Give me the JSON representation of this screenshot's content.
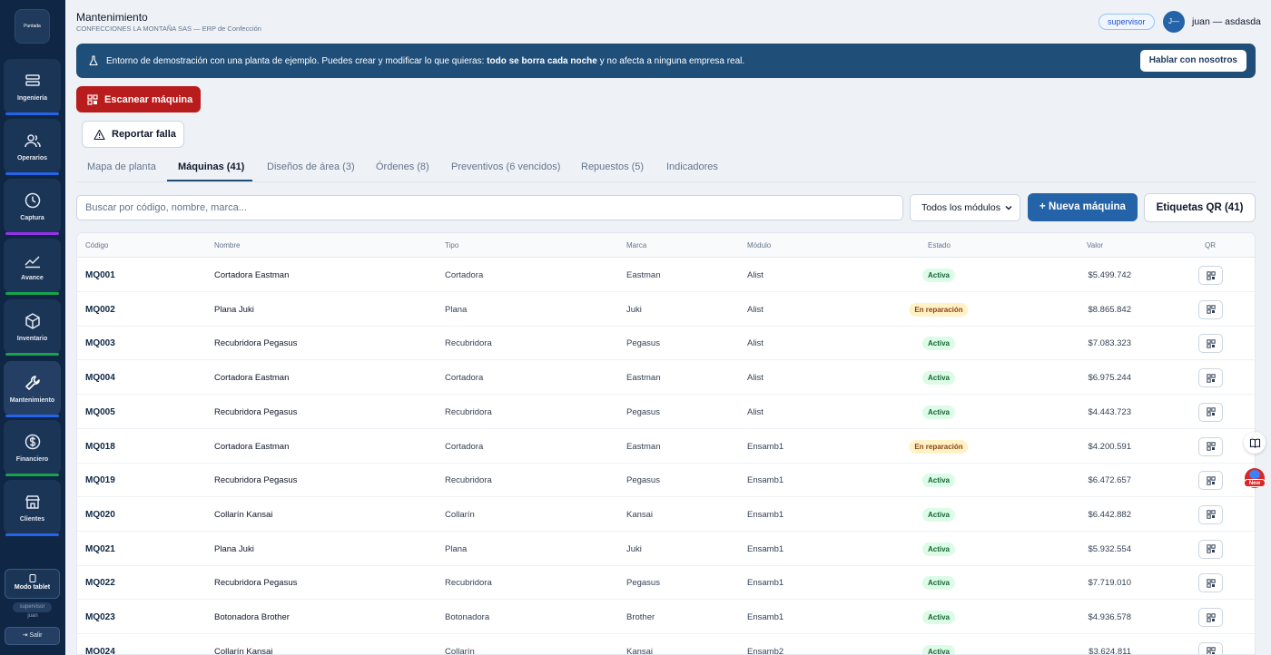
{
  "sidebar": {
    "logo_text": "Puntada",
    "items": [
      {
        "label": "Ingeniería",
        "icon": "machine-icon",
        "accent": "#2563eb"
      },
      {
        "label": "Operarios",
        "icon": "users-icon",
        "accent": "#2563eb"
      },
      {
        "label": "Captura",
        "icon": "clock-icon",
        "accent": "#9333ea"
      },
      {
        "label": "Avance",
        "icon": "trend-icon",
        "accent": "#16a34a"
      },
      {
        "label": "Inventario",
        "icon": "box-icon",
        "accent": "#16a34a"
      },
      {
        "label": "Mantenimiento",
        "icon": "wrench-icon",
        "accent": "#2563eb"
      },
      {
        "label": "Financiero",
        "icon": "dollar-icon",
        "accent": "#16a34a"
      },
      {
        "label": "Clientes",
        "icon": "store-icon",
        "accent": "#2563eb"
      }
    ],
    "tablet_label": "Modo tablet",
    "role": "supervisor",
    "user": "juan",
    "logout_label": "Salir"
  },
  "header": {
    "title": "Mantenimiento",
    "subtitle": "CONFECCIONES LA MONTAÑA SAS — ERP de Confección",
    "role_badge": "supervisor",
    "avatar_initials": "J—",
    "user_name": "juan — asdasda"
  },
  "banner": {
    "text_before": "Entorno de demostración con una planta de ejemplo. Puedes crear y modificar lo que quieras: ",
    "text_bold": "todo se borra cada noche",
    "text_after": " y no afecta a ninguna empresa real.",
    "button_label": "Hablar con nosotros"
  },
  "actions": {
    "scan_label": "Escanear máquina",
    "report_label": "Reportar falla"
  },
  "tabs": [
    {
      "label": "Mapa de planta",
      "active": false
    },
    {
      "label": "Máquinas (41)",
      "active": true
    },
    {
      "label": "Diseños de área (3)",
      "active": false
    },
    {
      "label": "Órdenes (8)",
      "active": false
    },
    {
      "label": "Preventivos (6 vencidos)",
      "active": false
    },
    {
      "label": "Repuestos (5)",
      "active": false
    },
    {
      "label": "Indicadores",
      "active": false
    }
  ],
  "toolbar": {
    "search_placeholder": "Buscar por código, nombre, marca...",
    "module_filter": "Todos los módulos",
    "new_machine_label": "+ Nueva máquina",
    "qr_labels_label": "Etiquetas QR (41)"
  },
  "table": {
    "columns": [
      "Código",
      "Nombre",
      "Tipo",
      "Marca",
      "Módulo",
      "Estado",
      "Valor",
      "QR"
    ],
    "rows": [
      {
        "code": "MQ001",
        "name": "Cortadora Eastman",
        "type": "Cortadora",
        "brand": "Eastman",
        "module": "Alist",
        "status": "Activa",
        "status_kind": "ok",
        "value": "$5.499.742"
      },
      {
        "code": "MQ002",
        "name": "Plana Juki",
        "type": "Plana",
        "brand": "Juki",
        "module": "Alist",
        "status": "En reparación",
        "status_kind": "rep",
        "value": "$8.865.842"
      },
      {
        "code": "MQ003",
        "name": "Recubridora Pegasus",
        "type": "Recubridora",
        "brand": "Pegasus",
        "module": "Alist",
        "status": "Activa",
        "status_kind": "ok",
        "value": "$7.083.323"
      },
      {
        "code": "MQ004",
        "name": "Cortadora Eastman",
        "type": "Cortadora",
        "brand": "Eastman",
        "module": "Alist",
        "status": "Activa",
        "status_kind": "ok",
        "value": "$6.975.244"
      },
      {
        "code": "MQ005",
        "name": "Recubridora Pegasus",
        "type": "Recubridora",
        "brand": "Pegasus",
        "module": "Alist",
        "status": "Activa",
        "status_kind": "ok",
        "value": "$4.443.723"
      },
      {
        "code": "MQ018",
        "name": "Cortadora Eastman",
        "type": "Cortadora",
        "brand": "Eastman",
        "module": "Ensamb1",
        "status": "En reparación",
        "status_kind": "rep",
        "value": "$4.200.591"
      },
      {
        "code": "MQ019",
        "name": "Recubridora Pegasus",
        "type": "Recubridora",
        "brand": "Pegasus",
        "module": "Ensamb1",
        "status": "Activa",
        "status_kind": "ok",
        "value": "$6.472.657"
      },
      {
        "code": "MQ020",
        "name": "Collarín Kansai",
        "type": "Collarín",
        "brand": "Kansai",
        "module": "Ensamb1",
        "status": "Activa",
        "status_kind": "ok",
        "value": "$6.442.882"
      },
      {
        "code": "MQ021",
        "name": "Plana Juki",
        "type": "Plana",
        "brand": "Juki",
        "module": "Ensamb1",
        "status": "Activa",
        "status_kind": "ok",
        "value": "$5.932.554"
      },
      {
        "code": "MQ022",
        "name": "Recubridora Pegasus",
        "type": "Recubridora",
        "brand": "Pegasus",
        "module": "Ensamb1",
        "status": "Activa",
        "status_kind": "ok",
        "value": "$7.719.010"
      },
      {
        "code": "MQ023",
        "name": "Botonadora Brother",
        "type": "Botonadora",
        "brand": "Brother",
        "module": "Ensamb1",
        "status": "Activa",
        "status_kind": "ok",
        "value": "$4.936.578"
      },
      {
        "code": "MQ024",
        "name": "Collarín Kansai",
        "type": "Collarín",
        "brand": "Kansai",
        "module": "Ensamb2",
        "status": "Activa",
        "status_kind": "ok",
        "value": "$3.624.811"
      }
    ]
  },
  "floating": {
    "new_badge": "New"
  },
  "colors": {
    "sidebar_bg": "#0f2744",
    "accent": "#2563a8",
    "danger": "#b91c1c",
    "banner": "#1f4e79"
  }
}
